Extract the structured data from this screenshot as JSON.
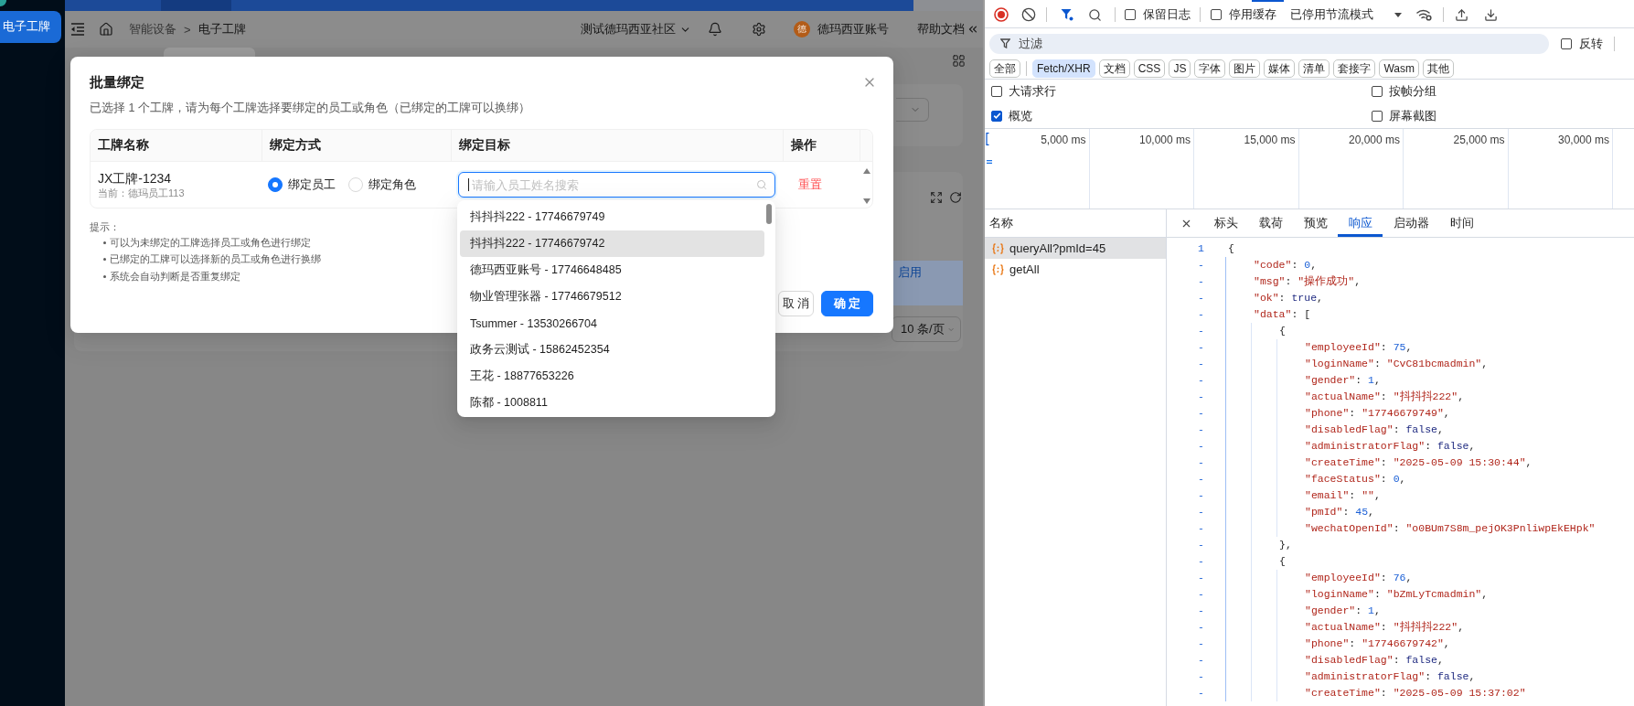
{
  "app": {
    "sidebar": {
      "items": [
        {
          "label": "电子工牌",
          "selected": true
        }
      ]
    },
    "header": {
      "breadcrumb": [
        {
          "label": "智能设备",
          "current": false
        },
        {
          "label": "电子工牌",
          "current": true
        }
      ],
      "separator": ">",
      "community": "测试德玛西亚社区",
      "avatar": "德",
      "account": "德玛西亚账号",
      "help": "帮助文档"
    },
    "page": {
      "status_link": "启用",
      "page_size": "10 条/页"
    },
    "modal": {
      "title": "批量绑定",
      "description": "已选择 1 个工牌，请为每个工牌选择要绑定的员工或角色（已绑定的工牌可以换绑）",
      "table": {
        "columns": [
          "工牌名称",
          "绑定方式",
          "绑定目标",
          "操作"
        ],
        "rows": [
          {
            "badge": "JX工牌-1234",
            "current_binding": "当前：德玛员工113",
            "modes": [
              {
                "label": "绑定员工",
                "selected": true
              },
              {
                "label": "绑定角色",
                "selected": false
              }
            ],
            "target": {
              "placeholder": "请输入员工姓名搜索",
              "focused": true,
              "options": [
                {
                  "label": "抖抖抖222 - 17746679749",
                  "highlighted": false
                },
                {
                  "label": "抖抖抖222 - 17746679742",
                  "highlighted": true
                },
                {
                  "label": "德玛西亚账号 - 17746648485",
                  "highlighted": false
                },
                {
                  "label": "物业管理张器 - 17746679512",
                  "highlighted": false
                },
                {
                  "label": "Tsummer - 13530266704",
                  "highlighted": false
                },
                {
                  "label": "政务云测试 - 15862452354",
                  "highlighted": false
                },
                {
                  "label": "王花 - 18877653226",
                  "highlighted": false
                },
                {
                  "label": "陈都 - 1008811",
                  "highlighted": false
                }
              ]
            },
            "action": "重置"
          }
        ]
      },
      "tips": {
        "title": "提示：",
        "items": [
          "可以为未绑定的工牌选择员工或角色进行绑定",
          "已绑定的工牌可以选择新的员工或角色进行换绑",
          "系统会自动判断是否重复绑定"
        ]
      },
      "buttons": [
        {
          "label": "取 消",
          "kind": "default"
        },
        {
          "label": "确 定",
          "kind": "primary"
        }
      ]
    }
  },
  "devtools": {
    "toolbar": {
      "preserve_log": {
        "label": "保留日志",
        "checked": false
      },
      "disable_cache": {
        "label": "停用缓存",
        "checked": false
      },
      "throttling": "已停用节流模式"
    },
    "filter": {
      "placeholder": "过滤",
      "invert": {
        "label": "反转",
        "checked": false
      }
    },
    "type_filters": [
      {
        "label": "全部",
        "selected": false
      },
      {
        "label": "Fetch/XHR",
        "selected": true
      },
      {
        "label": "文档",
        "selected": false
      },
      {
        "label": "CSS",
        "selected": false
      },
      {
        "label": "JS",
        "selected": false
      },
      {
        "label": "字体",
        "selected": false
      },
      {
        "label": "图片",
        "selected": false
      },
      {
        "label": "媒体",
        "selected": false
      },
      {
        "label": "清单",
        "selected": false
      },
      {
        "label": "套接字",
        "selected": false
      },
      {
        "label": "Wasm",
        "selected": false
      },
      {
        "label": "其他",
        "selected": false
      }
    ],
    "settings": [
      {
        "label": "大请求行",
        "checked": false
      },
      {
        "label": "按帧分组",
        "checked": false
      },
      {
        "label": "概览",
        "checked": true
      },
      {
        "label": "屏幕截图",
        "checked": false
      }
    ],
    "overview": {
      "ticks": [
        "5,000 ms",
        "10,000 ms",
        "15,000 ms",
        "20,000 ms",
        "25,000 ms",
        "30,000 ms"
      ]
    },
    "requests": {
      "header": "名称",
      "items": [
        {
          "name": "queryAll?pmId=45",
          "selected": true
        },
        {
          "name": "getAll",
          "selected": false
        }
      ]
    },
    "detail_tabs": [
      {
        "label": "标头",
        "selected": false
      },
      {
        "label": "载荷",
        "selected": false
      },
      {
        "label": "预览",
        "selected": false
      },
      {
        "label": "响应",
        "selected": true
      },
      {
        "label": "启动器",
        "selected": false
      },
      {
        "label": "时间",
        "selected": false
      }
    ],
    "response": {
      "lines": [
        {
          "gutter": "1",
          "tokens": [
            {
              "kind": "punct",
              "text": "{"
            }
          ],
          "children": [
            {
              "gutter": "-",
              "tokens": [
                {
                  "kind": "key",
                  "text": "\"code\""
                },
                {
                  "kind": "punct",
                  "text": ": "
                },
                {
                  "kind": "number",
                  "text": "0"
                },
                {
                  "kind": "punct",
                  "text": ","
                }
              ]
            },
            {
              "gutter": "-",
              "tokens": [
                {
                  "kind": "key",
                  "text": "\"msg\""
                },
                {
                  "kind": "punct",
                  "text": ": "
                },
                {
                  "kind": "string",
                  "text": "\"操作成功\""
                },
                {
                  "kind": "punct",
                  "text": ","
                }
              ]
            },
            {
              "gutter": "-",
              "tokens": [
                {
                  "kind": "key",
                  "text": "\"ok\""
                },
                {
                  "kind": "punct",
                  "text": ": "
                },
                {
                  "kind": "boolean",
                  "text": "true"
                },
                {
                  "kind": "punct",
                  "text": ","
                }
              ]
            },
            {
              "gutter": "-",
              "tokens": [
                {
                  "kind": "key",
                  "text": "\"data\""
                },
                {
                  "kind": "punct",
                  "text": ": ["
                }
              ],
              "children": [
                {
                  "gutter": "-",
                  "tokens": [
                    {
                      "kind": "punct",
                      "text": "{"
                    }
                  ],
                  "children": [
                    {
                      "gutter": "-",
                      "tokens": [
                        {
                          "kind": "key",
                          "text": "\"employeeId\""
                        },
                        {
                          "kind": "punct",
                          "text": ": "
                        },
                        {
                          "kind": "number",
                          "text": "75"
                        },
                        {
                          "kind": "punct",
                          "text": ","
                        }
                      ]
                    },
                    {
                      "gutter": "-",
                      "tokens": [
                        {
                          "kind": "key",
                          "text": "\"loginName\""
                        },
                        {
                          "kind": "punct",
                          "text": ": "
                        },
                        {
                          "kind": "string",
                          "text": "\"CvC81bcmadmin\""
                        },
                        {
                          "kind": "punct",
                          "text": ","
                        }
                      ]
                    },
                    {
                      "gutter": "-",
                      "tokens": [
                        {
                          "kind": "key",
                          "text": "\"gender\""
                        },
                        {
                          "kind": "punct",
                          "text": ": "
                        },
                        {
                          "kind": "number",
                          "text": "1"
                        },
                        {
                          "kind": "punct",
                          "text": ","
                        }
                      ]
                    },
                    {
                      "gutter": "-",
                      "tokens": [
                        {
                          "kind": "key",
                          "text": "\"actualName\""
                        },
                        {
                          "kind": "punct",
                          "text": ": "
                        },
                        {
                          "kind": "string",
                          "text": "\"抖抖抖222\""
                        },
                        {
                          "kind": "punct",
                          "text": ","
                        }
                      ]
                    },
                    {
                      "gutter": "-",
                      "tokens": [
                        {
                          "kind": "key",
                          "text": "\"phone\""
                        },
                        {
                          "kind": "punct",
                          "text": ": "
                        },
                        {
                          "kind": "string",
                          "text": "\"17746679749\""
                        },
                        {
                          "kind": "punct",
                          "text": ","
                        }
                      ]
                    },
                    {
                      "gutter": "-",
                      "tokens": [
                        {
                          "kind": "key",
                          "text": "\"disabledFlag\""
                        },
                        {
                          "kind": "punct",
                          "text": ": "
                        },
                        {
                          "kind": "boolean",
                          "text": "false"
                        },
                        {
                          "kind": "punct",
                          "text": ","
                        }
                      ]
                    },
                    {
                      "gutter": "-",
                      "tokens": [
                        {
                          "kind": "key",
                          "text": "\"administratorFlag\""
                        },
                        {
                          "kind": "punct",
                          "text": ": "
                        },
                        {
                          "kind": "boolean",
                          "text": "false"
                        },
                        {
                          "kind": "punct",
                          "text": ","
                        }
                      ]
                    },
                    {
                      "gutter": "-",
                      "tokens": [
                        {
                          "kind": "key",
                          "text": "\"createTime\""
                        },
                        {
                          "kind": "punct",
                          "text": ": "
                        },
                        {
                          "kind": "string",
                          "text": "\"2025-05-09 15:30:44\""
                        },
                        {
                          "kind": "punct",
                          "text": ","
                        }
                      ]
                    },
                    {
                      "gutter": "-",
                      "tokens": [
                        {
                          "kind": "key",
                          "text": "\"faceStatus\""
                        },
                        {
                          "kind": "punct",
                          "text": ": "
                        },
                        {
                          "kind": "number",
                          "text": "0"
                        },
                        {
                          "kind": "punct",
                          "text": ","
                        }
                      ]
                    },
                    {
                      "gutter": "-",
                      "tokens": [
                        {
                          "kind": "key",
                          "text": "\"email\""
                        },
                        {
                          "kind": "punct",
                          "text": ": "
                        },
                        {
                          "kind": "string",
                          "text": "\"\""
                        },
                        {
                          "kind": "punct",
                          "text": ","
                        }
                      ]
                    },
                    {
                      "gutter": "-",
                      "tokens": [
                        {
                          "kind": "key",
                          "text": "\"pmId\""
                        },
                        {
                          "kind": "punct",
                          "text": ": "
                        },
                        {
                          "kind": "number",
                          "text": "45"
                        },
                        {
                          "kind": "punct",
                          "text": ","
                        }
                      ]
                    },
                    {
                      "gutter": "-",
                      "tokens": [
                        {
                          "kind": "key",
                          "text": "\"wechatOpenId\""
                        },
                        {
                          "kind": "punct",
                          "text": ": "
                        },
                        {
                          "kind": "string",
                          "text": "\"o0BUm7S8m_pejOK3PnliwpEkEHpk\""
                        }
                      ]
                    }
                  ]
                },
                {
                  "gutter": "-",
                  "tokens": [
                    {
                      "kind": "punct",
                      "text": "},"
                    }
                  ]
                },
                {
                  "gutter": "-",
                  "tokens": [
                    {
                      "kind": "punct",
                      "text": "{"
                    }
                  ],
                  "children": [
                    {
                      "gutter": "-",
                      "tokens": [
                        {
                          "kind": "key",
                          "text": "\"employeeId\""
                        },
                        {
                          "kind": "punct",
                          "text": ": "
                        },
                        {
                          "kind": "number",
                          "text": "76"
                        },
                        {
                          "kind": "punct",
                          "text": ","
                        }
                      ]
                    },
                    {
                      "gutter": "-",
                      "tokens": [
                        {
                          "kind": "key",
                          "text": "\"loginName\""
                        },
                        {
                          "kind": "punct",
                          "text": ": "
                        },
                        {
                          "kind": "string",
                          "text": "\"bZmLyTcmadmin\""
                        },
                        {
                          "kind": "punct",
                          "text": ","
                        }
                      ]
                    },
                    {
                      "gutter": "-",
                      "tokens": [
                        {
                          "kind": "key",
                          "text": "\"gender\""
                        },
                        {
                          "kind": "punct",
                          "text": ": "
                        },
                        {
                          "kind": "number",
                          "text": "1"
                        },
                        {
                          "kind": "punct",
                          "text": ","
                        }
                      ]
                    },
                    {
                      "gutter": "-",
                      "tokens": [
                        {
                          "kind": "key",
                          "text": "\"actualName\""
                        },
                        {
                          "kind": "punct",
                          "text": ": "
                        },
                        {
                          "kind": "string",
                          "text": "\"抖抖抖222\""
                        },
                        {
                          "kind": "punct",
                          "text": ","
                        }
                      ]
                    },
                    {
                      "gutter": "-",
                      "tokens": [
                        {
                          "kind": "key",
                          "text": "\"phone\""
                        },
                        {
                          "kind": "punct",
                          "text": ": "
                        },
                        {
                          "kind": "string",
                          "text": "\"17746679742\""
                        },
                        {
                          "kind": "punct",
                          "text": ","
                        }
                      ]
                    },
                    {
                      "gutter": "-",
                      "tokens": [
                        {
                          "kind": "key",
                          "text": "\"disabledFlag\""
                        },
                        {
                          "kind": "punct",
                          "text": ": "
                        },
                        {
                          "kind": "boolean",
                          "text": "false"
                        },
                        {
                          "kind": "punct",
                          "text": ","
                        }
                      ]
                    },
                    {
                      "gutter": "-",
                      "tokens": [
                        {
                          "kind": "key",
                          "text": "\"administratorFlag\""
                        },
                        {
                          "kind": "punct",
                          "text": ": "
                        },
                        {
                          "kind": "boolean",
                          "text": "false"
                        },
                        {
                          "kind": "punct",
                          "text": ","
                        }
                      ]
                    },
                    {
                      "gutter": "-",
                      "tokens": [
                        {
                          "kind": "key",
                          "text": "\"createTime\""
                        },
                        {
                          "kind": "punct",
                          "text": ": "
                        },
                        {
                          "kind": "string",
                          "text": "\"2025-05-09 15:37:02\""
                        }
                      ]
                    }
                  ]
                }
              ]
            }
          ]
        }
      ]
    }
  }
}
